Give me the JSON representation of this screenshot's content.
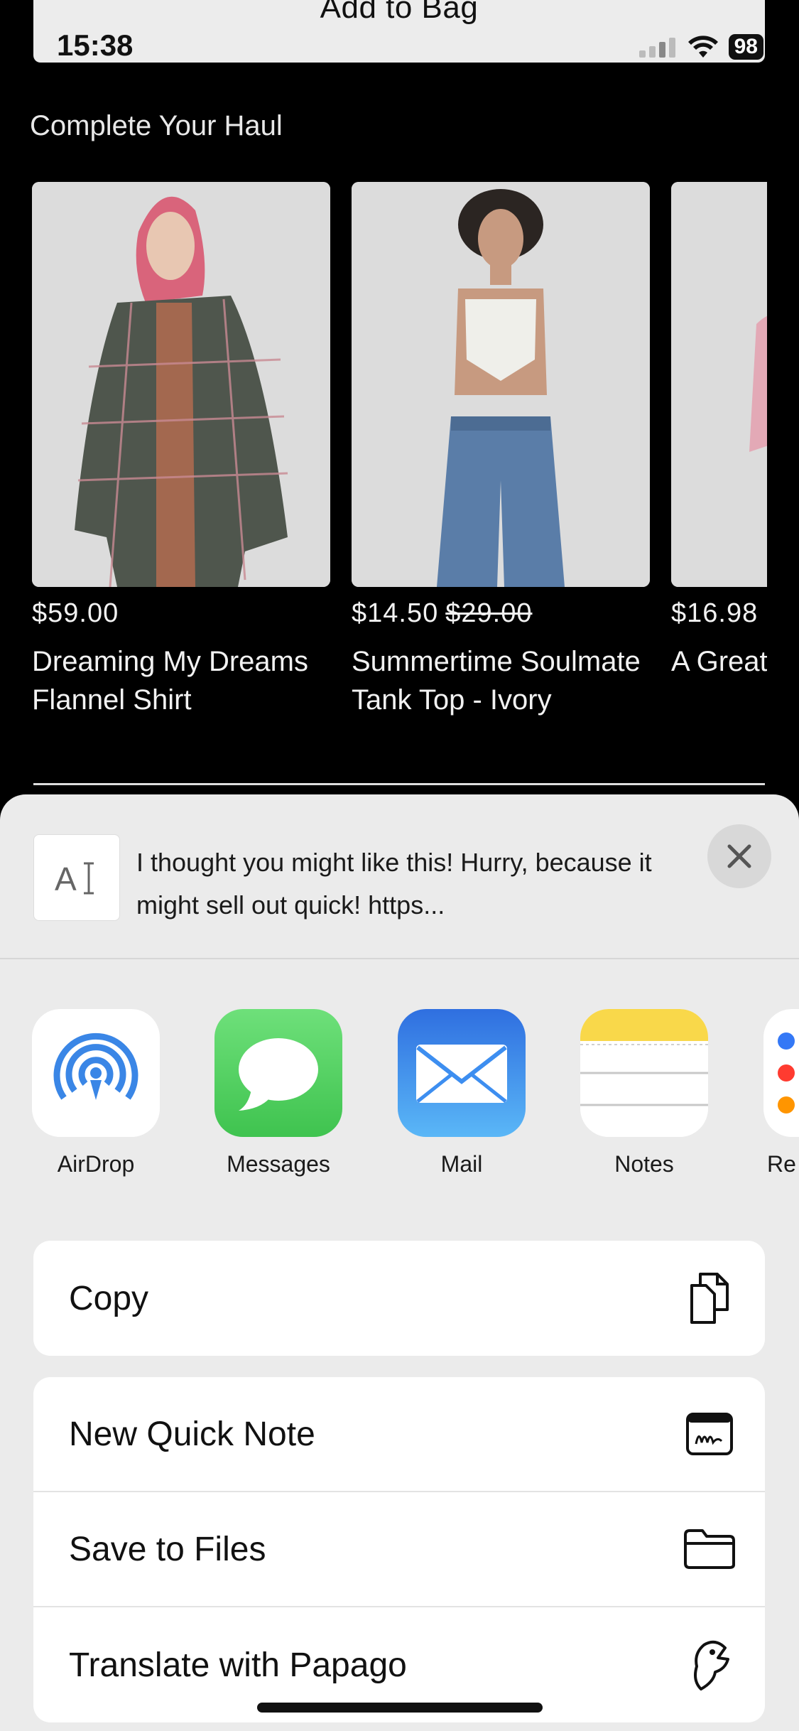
{
  "status": {
    "time": "15:38",
    "battery": "98"
  },
  "header": {
    "add_to_bag": "Add to Bag"
  },
  "haul": {
    "title": "Complete Your Haul",
    "products": [
      {
        "price": "$59.00",
        "old_price": "",
        "name": "Dreaming My Dreams Flannel Shirt"
      },
      {
        "price": "$14.50",
        "old_price": "$29.00",
        "name": "Summertime Soulmate Tank Top - Ivory"
      },
      {
        "price": "$16.98",
        "old_price": "",
        "name": "A Great Top"
      }
    ]
  },
  "share": {
    "preview_text": "I thought you might like this! Hurry, because it might sell out quick! https...",
    "preview_icon_label": "A",
    "apps": [
      {
        "label": "AirDrop",
        "icon": "airdrop-icon"
      },
      {
        "label": "Messages",
        "icon": "messages-icon"
      },
      {
        "label": "Mail",
        "icon": "mail-icon"
      },
      {
        "label": "Notes",
        "icon": "notes-icon"
      },
      {
        "label": "Re",
        "icon": "reminders-icon"
      }
    ],
    "actions_group1": [
      {
        "label": "Copy",
        "icon": "copy-icon"
      }
    ],
    "actions_group2": [
      {
        "label": "New Quick Note",
        "icon": "quick-note-icon"
      },
      {
        "label": "Save to Files",
        "icon": "folder-icon"
      },
      {
        "label": "Translate with Papago",
        "icon": "papago-icon"
      }
    ]
  },
  "colors": {
    "background": "#000000",
    "sheet": "#ebebeb",
    "messages_green": "#4cd964",
    "mail_blue": "#3b8cf3",
    "notes_yellow": "#f9d84a",
    "airdrop_blue": "#3a86e6"
  }
}
